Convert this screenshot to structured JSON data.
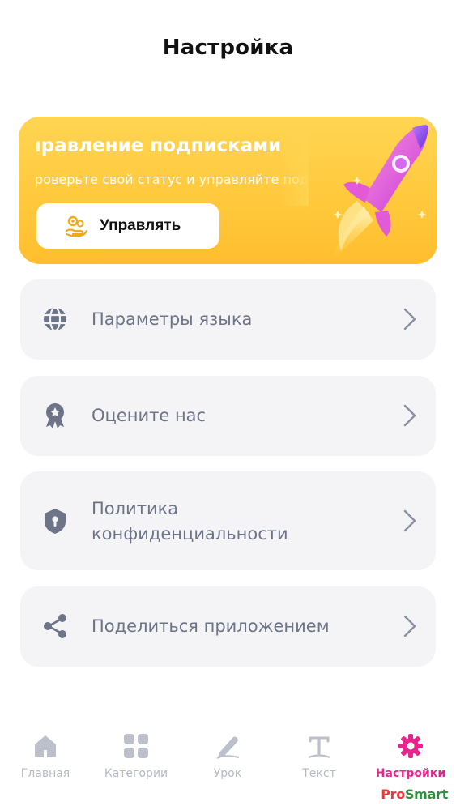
{
  "header": {
    "title": "Настройка"
  },
  "promo": {
    "title": "Управление подписками",
    "subtitle": "Проверьте свой статус и управляйте подпиской",
    "button_label": "Управлять",
    "button_icon": "gears-hand-icon",
    "illustration": "rocket-icon"
  },
  "menu": {
    "items": [
      {
        "label": "Параметры языка",
        "icon": "globe-icon"
      },
      {
        "label": "Оцените нас",
        "icon": "award-badge-icon"
      },
      {
        "label_line1": "Политика",
        "label_line2": "конфиденциальности",
        "icon": "shield-lock-icon"
      },
      {
        "label": "Поделиться приложением",
        "icon": "share-icon"
      }
    ]
  },
  "tabbar": {
    "tabs": [
      {
        "label": "Главная",
        "icon": "home-icon",
        "active": false
      },
      {
        "label": "Категории",
        "icon": "grid-icon",
        "active": false
      },
      {
        "label": "Урок",
        "icon": "pen-icon",
        "active": false
      },
      {
        "label": "Текст",
        "icon": "text-icon",
        "active": false
      },
      {
        "label": "Настройки",
        "icon": "gear-icon",
        "active": true
      }
    ]
  },
  "watermark": {
    "pro": "Pro",
    "smart": "Smart"
  },
  "colors": {
    "promo_background": "#ffc93d",
    "menu_background": "#f4f4f6",
    "menu_text": "#6d7488",
    "tab_inactive": "#b5b9c4",
    "tab_active": "#e8258c"
  }
}
